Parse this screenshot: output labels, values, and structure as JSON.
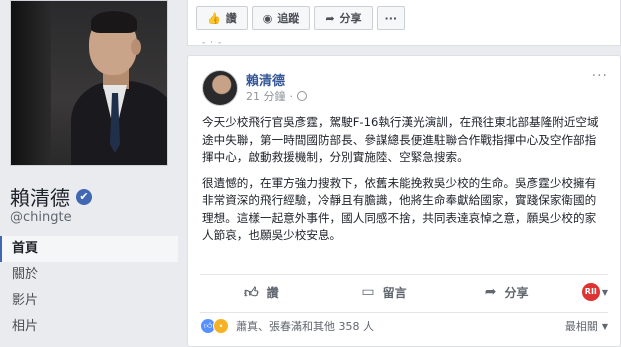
{
  "profile": {
    "name": "賴清德",
    "handle": "@chingte",
    "verified_badge": "✔"
  },
  "nav": {
    "items": [
      {
        "label": "首頁",
        "active": true
      },
      {
        "label": "關於",
        "active": false
      },
      {
        "label": "影片",
        "active": false
      },
      {
        "label": "相片",
        "active": false
      }
    ]
  },
  "prev_post": {
    "like_label": "讚",
    "follow_label": "追蹤",
    "share_label": "分享",
    "more_label": "···",
    "truncated": "- · -"
  },
  "post": {
    "author": "賴清德",
    "time": "21 分鐘",
    "privacy_icon": "globe-icon",
    "more_label": "···",
    "paragraphs": [
      "今天少校飛行官吳彥霆，駕駛F-16執行漢光演訓，在飛往東北部基隆附近空域途中失聯，第一時間國防部長、參謀總長便進駐聯合作戰指揮中心及空作部指揮中心，啟動救援機制，分別實施陸、空緊急搜索。",
      "很遺憾的，在軍方強力搜救下，依舊未能挽救吳少校的生命。吳彥霆少校擁有非常資深的飛行經驗，冷靜且有膽識，他將生命奉獻給國家，實踐保家衛國的理想。這樣一起意外事件，國人同感不捨，共同表達哀悼之意，願吳少校的家人節哀，也願吳少校安息。"
    ],
    "actions": {
      "like_label": "讚",
      "comment_label": "留言",
      "share_label": "分享"
    },
    "reactions": {
      "reactors_text": "蕭真、張春滿和其他 358 人",
      "sort_label": "最相關"
    }
  },
  "colors": {
    "link_blue": "#365899",
    "facebook_blue": "#4267b2",
    "background": "#e9ebee"
  }
}
